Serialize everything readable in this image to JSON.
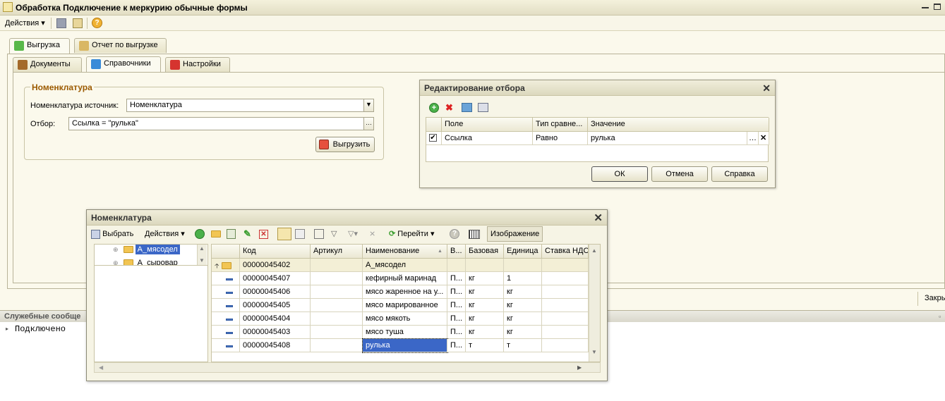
{
  "window": {
    "title": "Обработка  Подключение к меркурию обычные формы"
  },
  "menu": {
    "actions": "Действия"
  },
  "main_tabs": [
    "Выгрузка",
    "Отчет по выгрузке"
  ],
  "sub_tabs": [
    "Документы",
    "Справочники",
    "Настройки"
  ],
  "group": {
    "title": "Номенклатура",
    "source_label": "Номенклатура источник:",
    "source_value": "Номенклатура",
    "filter_label": "Отбор:",
    "filter_value": "Ссылка = \"рулька\"",
    "export_button": "Выгрузить"
  },
  "filter_dialog": {
    "title": "Редактирование отбора",
    "columns": [
      "Поле",
      "Тип сравне...",
      "Значение"
    ],
    "row": {
      "field": "Ссылка",
      "compare": "Равно",
      "value": "рулька"
    },
    "buttons": {
      "ok": "ОК",
      "cancel": "Отмена",
      "help": "Справка"
    }
  },
  "close_label": "Закры",
  "messages": {
    "header": "Служебные сообще",
    "lines": [
      "Подключено"
    ]
  },
  "nomen_window": {
    "title": "Номенклатура",
    "toolbar": {
      "select": "Выбрать",
      "actions": "Действия",
      "goto": "Перейти",
      "image": "Изображение"
    },
    "tree": [
      "А_мясодел",
      "А_сыровар"
    ],
    "columns": [
      "Код",
      "Артикул",
      "Наименование",
      "В...",
      "Базовая",
      "Единица",
      "Ставка НДС"
    ],
    "rows": [
      {
        "code": "00000045402",
        "article": "",
        "name": "А_мясодел",
        "v": "",
        "base": "",
        "unit": "",
        "vat": "",
        "type": "folder"
      },
      {
        "code": "00000045407",
        "article": "",
        "name": "кефирный маринад",
        "v": "П...",
        "base": "кг",
        "unit": "1",
        "vat": "",
        "type": "item"
      },
      {
        "code": "00000045406",
        "article": "",
        "name": "мясо жаренное на у...",
        "v": "П...",
        "base": "кг",
        "unit": "кг",
        "vat": "",
        "type": "item"
      },
      {
        "code": "00000045405",
        "article": "",
        "name": "мясо марированное",
        "v": "П...",
        "base": "кг",
        "unit": "кг",
        "vat": "",
        "type": "item"
      },
      {
        "code": "00000045404",
        "article": "",
        "name": "мясо мякоть",
        "v": "П...",
        "base": "кг",
        "unit": "кг",
        "vat": "",
        "type": "item"
      },
      {
        "code": "00000045403",
        "article": "",
        "name": "мясо туша",
        "v": "П...",
        "base": "кг",
        "unit": "кг",
        "vat": "",
        "type": "item"
      },
      {
        "code": "00000045408",
        "article": "",
        "name": "рулька",
        "v": "П...",
        "base": "т",
        "unit": "т",
        "vat": "",
        "type": "item"
      }
    ]
  }
}
